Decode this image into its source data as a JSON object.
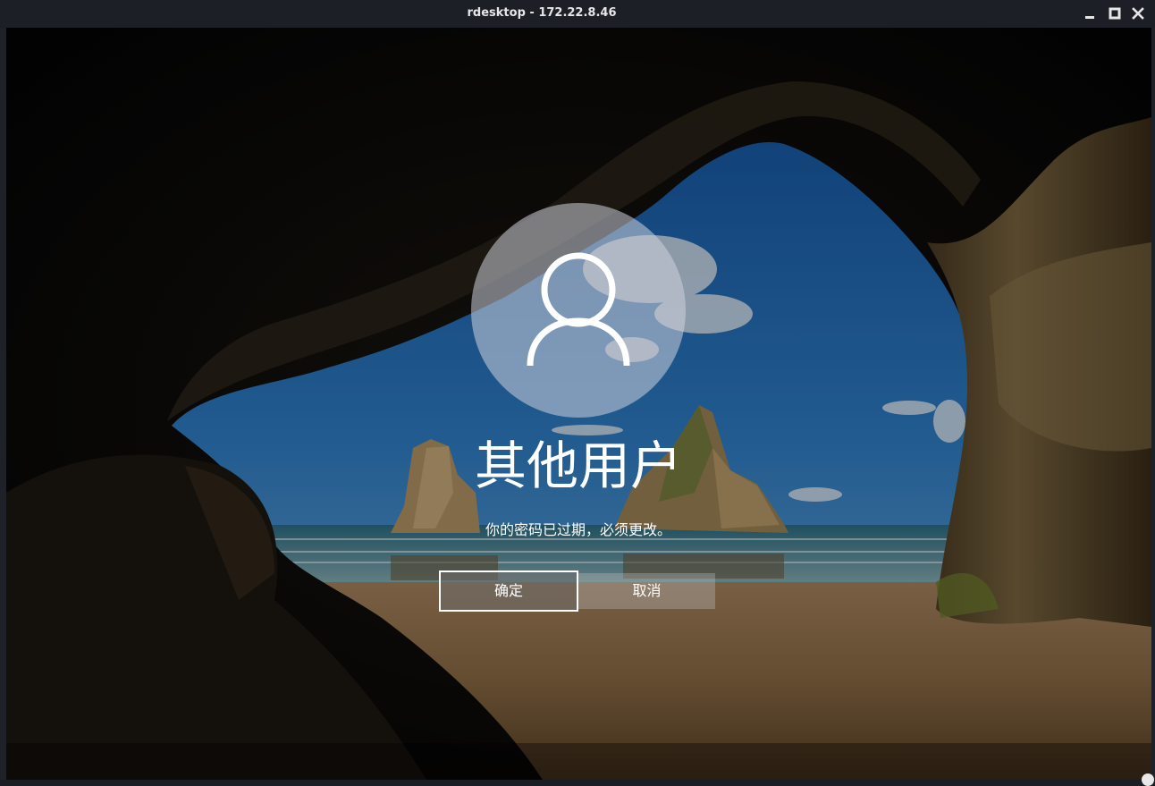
{
  "window": {
    "title": "rdesktop - 172.22.8.46",
    "controls": {
      "minimize_icon": "minimize-icon",
      "maximize_icon": "maximize-icon",
      "close_icon": "close-icon"
    }
  },
  "login": {
    "avatar_icon": "user-icon",
    "username": "其他用户",
    "message": "你的密码已过期，必须更改。",
    "ok_label": "确定",
    "cancel_label": "取消"
  },
  "colors": {
    "titlebar": "#1d1f27",
    "sky": "#2f7fc8",
    "sand": "#8a6a44",
    "rock": "#6e5a3a",
    "button_text": "#ffffff"
  }
}
